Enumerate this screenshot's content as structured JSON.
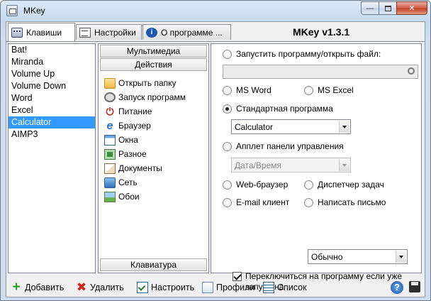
{
  "window": {
    "title": "MKey"
  },
  "tabs": [
    {
      "label": "Клавиши",
      "icon": "keyboard-icon",
      "active": true
    },
    {
      "label": "Настройки",
      "icon": "settings-icon",
      "active": false
    },
    {
      "label": "О программе ...",
      "icon": "info-icon",
      "active": false
    }
  ],
  "version": "MKey v1.3.1",
  "keys_list": {
    "items": [
      "Bat!",
      "Miranda",
      "Volume Up",
      "Volume Down",
      "Word",
      "Excel",
      "Calculator",
      "AIMP3"
    ],
    "selected_index": 6
  },
  "categories": {
    "header_multimedia": "Мультимедиа",
    "header_actions": "Действия",
    "header_keyboard": "Клавиатура",
    "actions": [
      {
        "label": "Открыть папку",
        "icon": "folder-icon"
      },
      {
        "label": "Запуск программ",
        "icon": "gear-icon"
      },
      {
        "label": "Питание",
        "icon": "power-icon"
      },
      {
        "label": "Браузер",
        "icon": "browser-icon"
      },
      {
        "label": "Окна",
        "icon": "window-icon"
      },
      {
        "label": "Разное",
        "icon": "misc-icon"
      },
      {
        "label": "Документы",
        "icon": "documents-icon"
      },
      {
        "label": "Сеть",
        "icon": "network-icon"
      },
      {
        "label": "Обои",
        "icon": "wallpaper-icon"
      }
    ]
  },
  "settings": {
    "run_program_label": "Запустить программу/открыть файл:",
    "run_program_path": "",
    "ms_word_label": "MS Word",
    "ms_excel_label": "MS Excel",
    "standard_program_label": "Стандартная программа",
    "standard_program_value": "Calculator",
    "control_panel_label": "Апплет панели управления",
    "control_panel_value": "Дата/Время",
    "web_browser_label": "Web-браузер",
    "task_manager_label": "Диспетчер задач",
    "email_client_label": "E-mail клиент",
    "write_letter_label": "Написать письмо",
    "selected_option": "standard_program",
    "window_state_value": "Обычно",
    "switch_if_running_label": "Переключиться на программу если уже запущена",
    "switch_if_running_checked": true
  },
  "toolbar": {
    "add_label": "Добавить",
    "delete_label": "Удалить",
    "configure_label": "Настроить",
    "profiles_label": "Профили",
    "list_label": "Список"
  }
}
